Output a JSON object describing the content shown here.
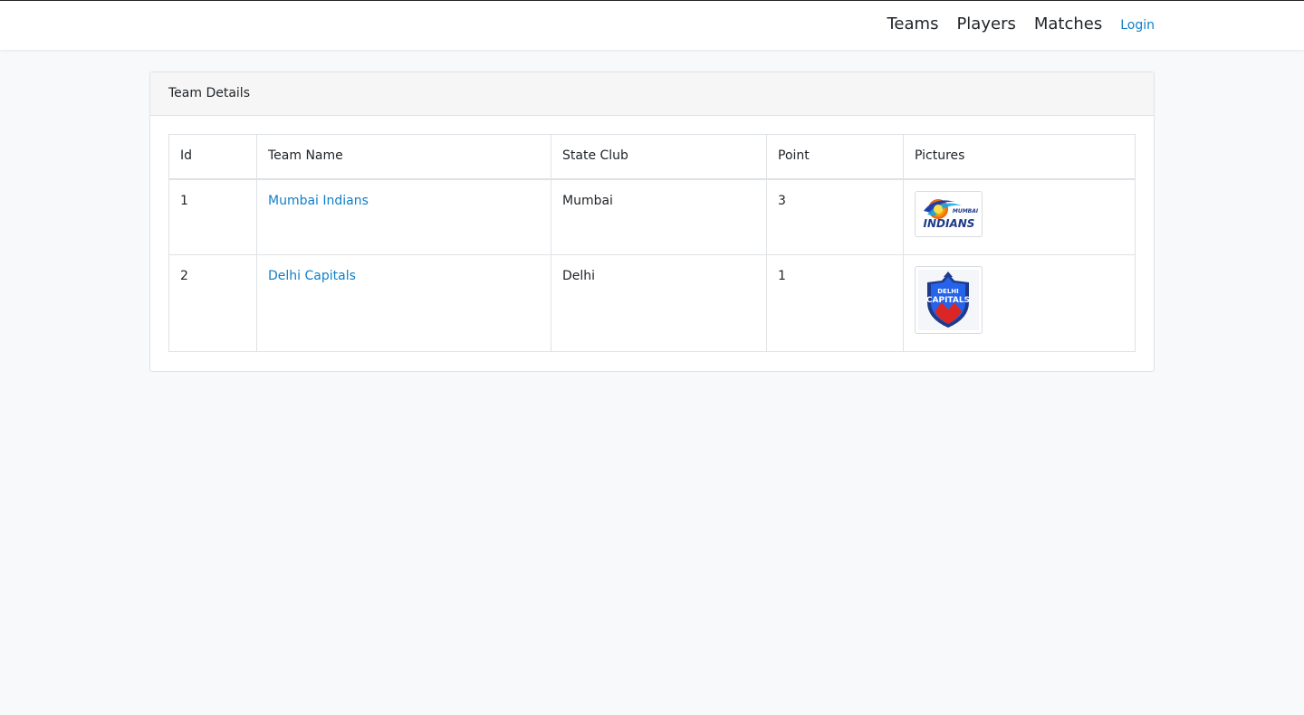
{
  "nav": {
    "teams": "Teams",
    "players": "Players",
    "matches": "Matches",
    "login": "Login"
  },
  "card": {
    "title": "Team Details"
  },
  "table": {
    "headers": [
      "Id",
      "Team Name",
      "State Club",
      "Point",
      "Pictures"
    ],
    "rows": [
      {
        "id": "1",
        "team_name": "Mumbai Indians",
        "state_club": "Mumbai",
        "point": "3",
        "logo": "mumbai-indians-logo"
      },
      {
        "id": "2",
        "team_name": "Delhi Capitals",
        "state_club": "Delhi",
        "point": "1",
        "logo": "delhi-capitals-logo"
      }
    ]
  },
  "logos": {
    "mumbai": {
      "line1": "MUMBAI",
      "line2": "INDIANS"
    },
    "delhi": {
      "line1": "DELHI",
      "line2": "CAPITALS"
    }
  },
  "colors": {
    "link": "#0d7fc9",
    "background": "#f8f9fb"
  }
}
